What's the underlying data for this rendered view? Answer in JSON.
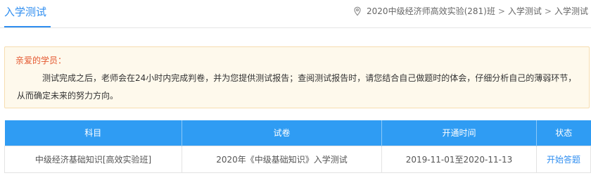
{
  "header": {
    "title": "入学测试",
    "breadcrumb": [
      "2020中级经济师高效实验(281)班",
      "入学测试",
      "入学测试"
    ],
    "separator": ">"
  },
  "notice": {
    "greeting": "亲爱的学员：",
    "body": "测试完成之后，老师会在24小时内完成判卷，并为您提供测试报告；查阅测试报告时，请您结合自己做题时的体会，仔细分析自己的薄弱环节，从而确定未来的努力方向。"
  },
  "table": {
    "headers": [
      "科目",
      "试卷",
      "开通时间",
      "状态"
    ],
    "rows": [
      {
        "subject": "中级经济基础知识[高效实验班]",
        "paper": "2020年《中级基础知识》入学测试",
        "time": "2019-11-01至2020-11-13",
        "status": "开始答题"
      }
    ]
  },
  "colors": {
    "accent": "#2f8ef0",
    "header_bg": "#2f9cf3",
    "notice_bg": "#fef9ec",
    "greeting": "#e4572e"
  },
  "icons": {
    "location": "location-pin-icon"
  }
}
